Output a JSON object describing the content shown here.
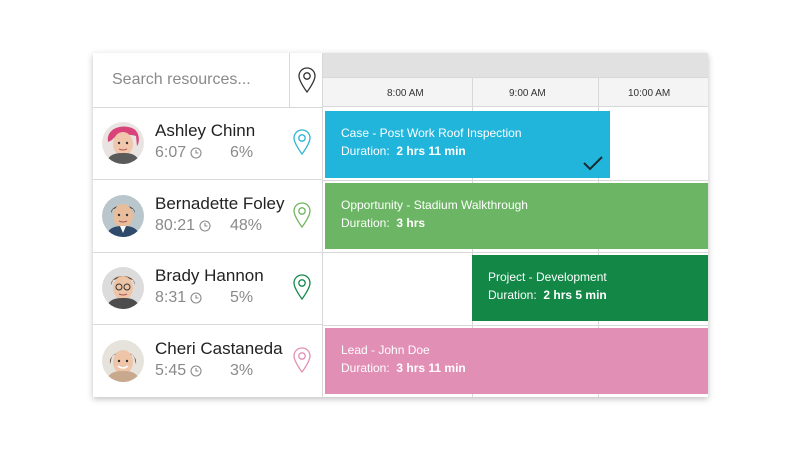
{
  "search": {
    "placeholder": "Search resources..."
  },
  "timeline": {
    "slots": [
      "8:00  AM",
      "9:00  AM",
      "10:00  AM"
    ]
  },
  "resources": [
    {
      "name": "Ashley Chinn",
      "time": "6:07",
      "percent": "6%",
      "pin_color": "#2bb5d4"
    },
    {
      "name": "Bernadette Foley",
      "time": "80:21",
      "percent": "48%",
      "pin_color": "#6fb55f"
    },
    {
      "name": "Brady Hannon",
      "time": "8:31",
      "percent": "5%",
      "pin_color": "#14884a"
    },
    {
      "name": "Cheri Castaneda",
      "time": "5:45",
      "percent": "3%",
      "pin_color": "#e48fb3"
    }
  ],
  "bookings": [
    {
      "title": "Case - Post Work Roof Inspection",
      "duration_label": "Duration:",
      "duration": "2 hrs  11 min",
      "color": "#22b5dc",
      "completed": true
    },
    {
      "title": "Opportunity - Stadium Walkthrough",
      "duration_label": "Duration:",
      "duration": "3 hrs",
      "color": "#6cb564",
      "completed": false
    },
    {
      "title": "Project - Development",
      "duration_label": "Duration:",
      "duration": "2 hrs  5 min",
      "color": "#128746",
      "completed": false
    },
    {
      "title": "Lead - John Doe",
      "duration_label": "Duration:",
      "duration": "3 hrs  11 min",
      "color": "#e28fb5",
      "completed": false
    }
  ],
  "icons": {
    "search_pin": "map-pin-icon",
    "clock": "clock-icon",
    "check": "checkmark-icon"
  }
}
